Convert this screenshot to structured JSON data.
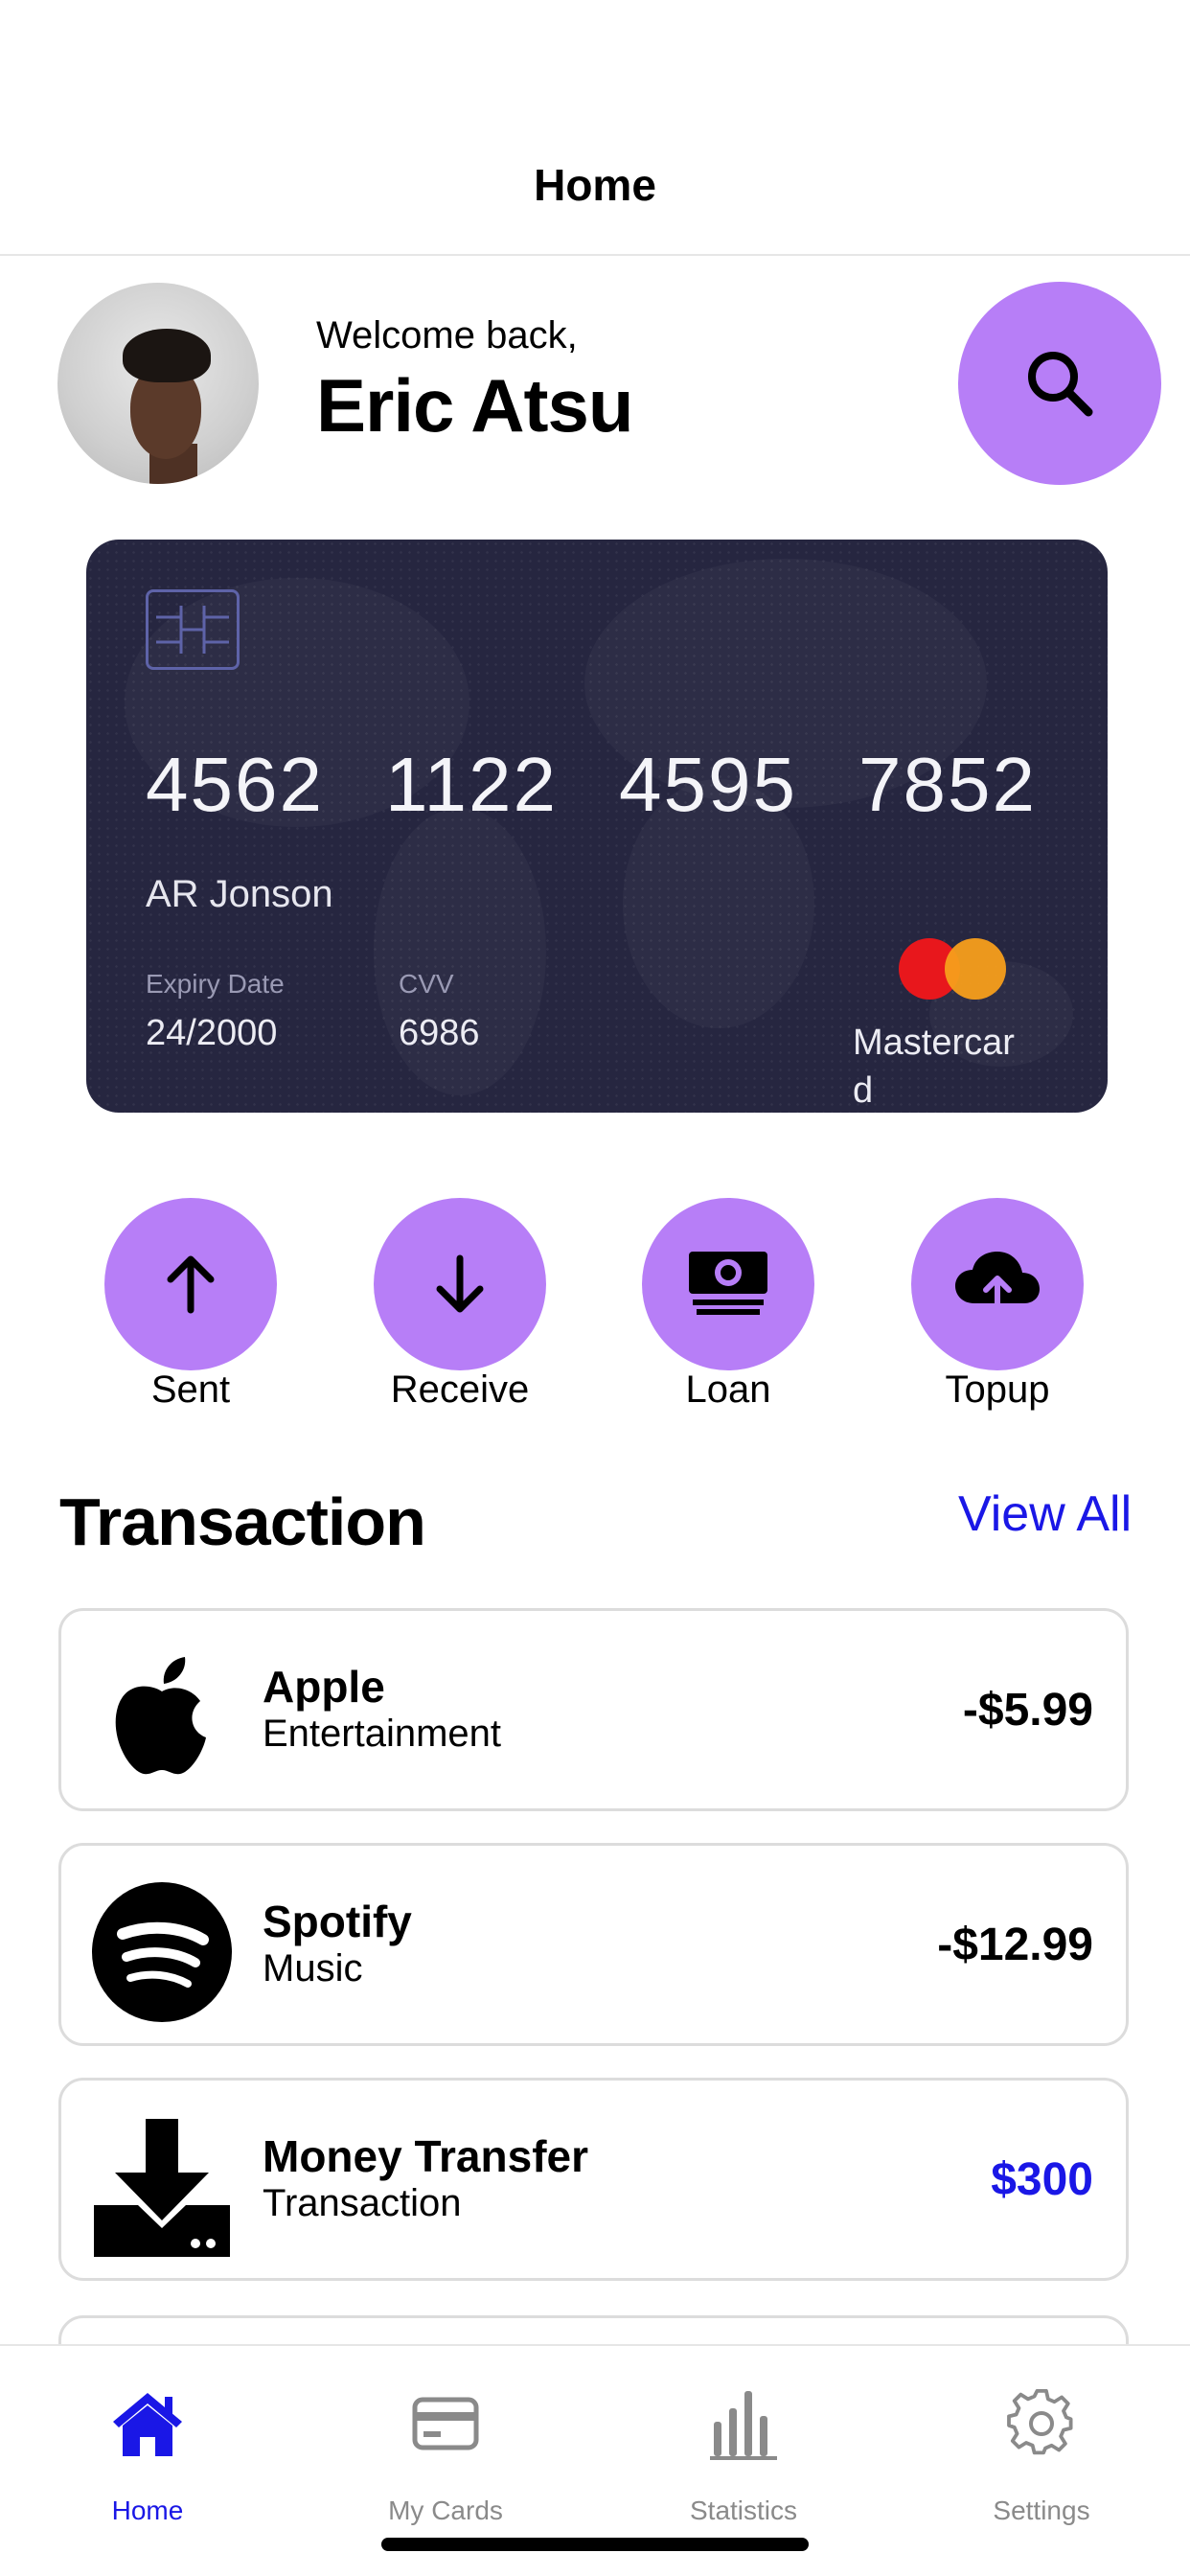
{
  "navbar": {
    "title": "Home"
  },
  "header": {
    "greeting": "Welcome back,",
    "user_name": "Eric Atsu"
  },
  "card": {
    "number_groups": [
      "4562",
      "1122",
      "4595",
      "7852"
    ],
    "holder": "AR Jonson",
    "expiry_label": "Expiry Date",
    "expiry_value": "24/2000",
    "cvv_label": "CVV",
    "cvv_value": "6986",
    "brand": "Mastercard",
    "colors": {
      "background": "#262640",
      "mc_red": "#e8171c",
      "mc_orange": "#f79e1b"
    }
  },
  "actions": [
    {
      "label": "Sent",
      "icon": "arrow-up-icon"
    },
    {
      "label": "Receive",
      "icon": "arrow-down-icon"
    },
    {
      "label": "Loan",
      "icon": "money-bill-icon"
    },
    {
      "label": "Topup",
      "icon": "cloud-upload-icon"
    }
  ],
  "transactions_section": {
    "title": "Transaction",
    "view_all": "View All",
    "items": [
      {
        "name": "Apple",
        "category": "Entertainment",
        "amount": "-$5.99",
        "icon": "apple-logo-icon"
      },
      {
        "name": "Spotify",
        "category": "Music",
        "amount": "-$12.99",
        "icon": "spotify-logo-icon"
      },
      {
        "name": "Money Transfer",
        "category": "Transaction",
        "amount": "$300",
        "icon": "download-icon"
      }
    ]
  },
  "tabbar": {
    "tabs": [
      {
        "label": "Home",
        "icon": "home-icon",
        "active": true
      },
      {
        "label": "My Cards",
        "icon": "credit-card-icon",
        "active": false
      },
      {
        "label": "Statistics",
        "icon": "bar-chart-icon",
        "active": false
      },
      {
        "label": "Settings",
        "icon": "gear-icon",
        "active": false
      }
    ]
  },
  "theme": {
    "accent": "#b77ef7",
    "link": "#1a17e6"
  }
}
